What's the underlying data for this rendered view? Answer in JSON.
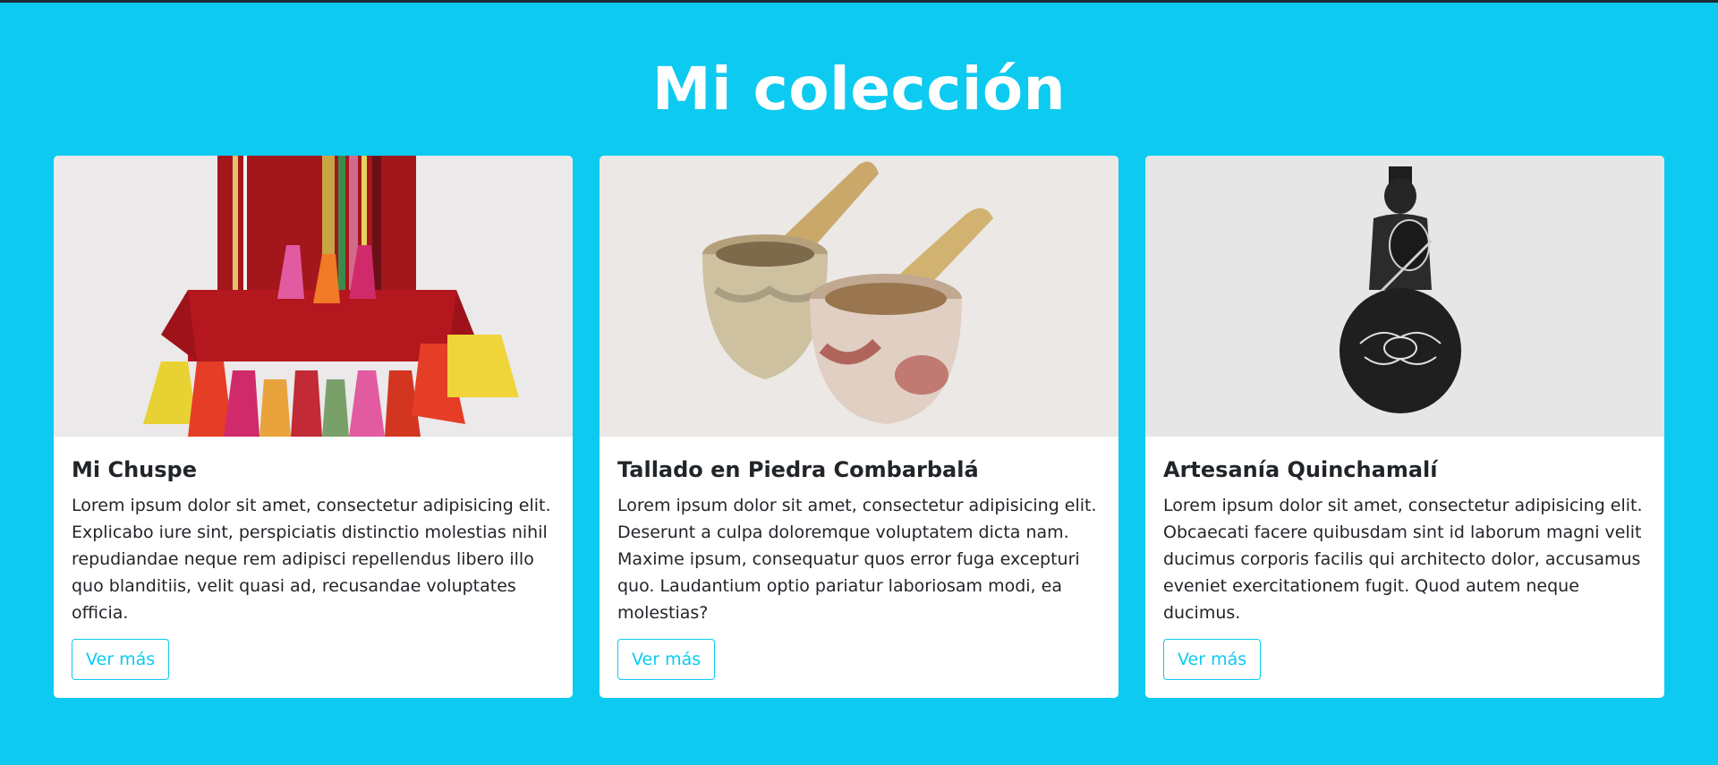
{
  "page": {
    "title": "Mi colección",
    "background_color": "#0dcaf0"
  },
  "cards": [
    {
      "title": "Mi Chuspe",
      "text": "Lorem ipsum dolor sit amet, consectetur adipisicing elit. Explicabo iure sint, perspiciatis distinctio molestias nihil repudiandae neque rem adipisci repellendus libero illo quo blanditiis, velit quasi ad, recusandae voluptates officia.",
      "button_label": "Ver más",
      "image": "chuspe-textile-bag"
    },
    {
      "title": "Tallado en Piedra Combarbalá",
      "text": "Lorem ipsum dolor sit amet, consectetur adipisicing elit. Deserunt a culpa doloremque voluptatem dicta nam. Maxime ipsum, consequatur quos error fuga excepturi quo. Laudantium optio pariatur laboriosam modi, ea molestias?",
      "button_label": "Ver más",
      "image": "stone-mortar-and-pestle"
    },
    {
      "title": "Artesanía Quinchamalí",
      "text": "Lorem ipsum dolor sit amet, consectetur adipisicing elit. Obcaecati facere quibusdam sint id laborum magni velit ducimus corporis facilis qui architecto dolor, accusamus eveniet exercitationem fugit. Quod autem neque ducimus.",
      "button_label": "Ver más",
      "image": "black-clay-guitarist-figure"
    }
  ]
}
